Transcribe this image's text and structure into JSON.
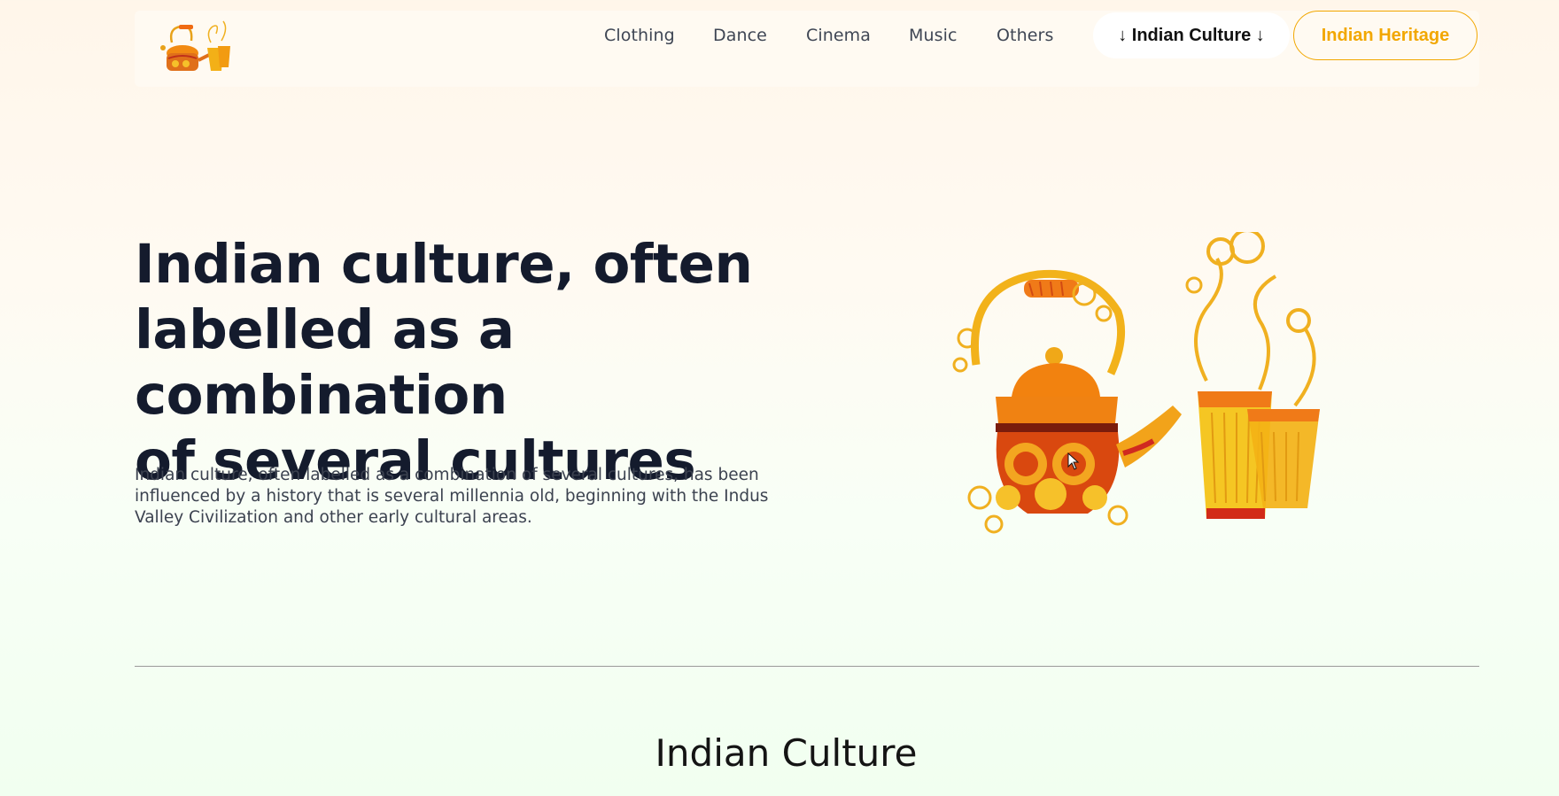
{
  "nav": {
    "logo_icon": "teapot-cups-logo",
    "links": [
      "Clothing",
      "Dance",
      "Cinema",
      "Music",
      "Others"
    ],
    "culture_button": "↓ Indian Culture ↓",
    "heritage_button": "Indian Heritage",
    "accent_color": "#f2a700"
  },
  "hero": {
    "title_lines": [
      "Indian culture, often",
      "labelled as a combination",
      "of several cultures"
    ],
    "description": "Indian culture, often labelled as a combination of several cultures, has been influenced by a history that is several millennia old, beginning with the Indus Valley Civilization and other early cultural areas.",
    "illustration_icon": "ornate-teapot-and-chai-cups"
  },
  "section": {
    "title": "Indian Culture"
  }
}
